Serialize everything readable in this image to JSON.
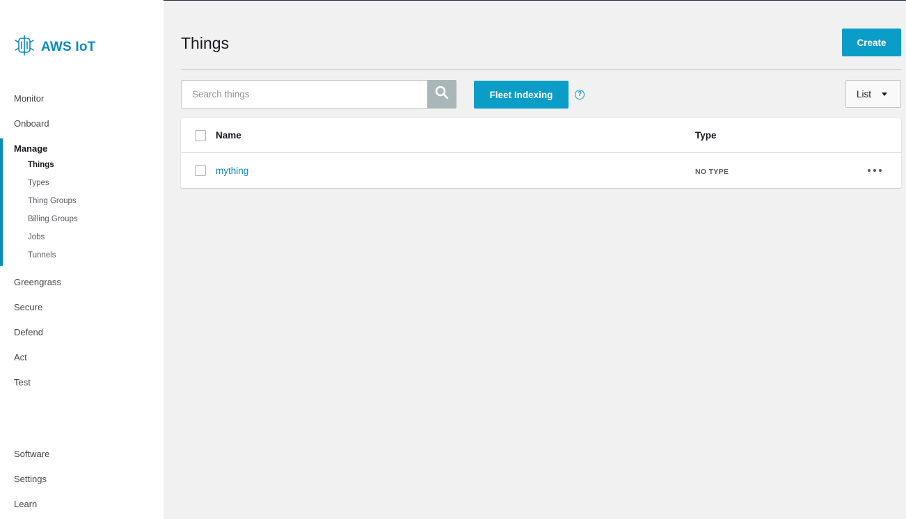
{
  "app": {
    "logo_text": "AWS IoT",
    "logo_icon": "iot-chip-icon"
  },
  "sidebar": {
    "items": [
      {
        "label": "Monitor"
      },
      {
        "label": "Onboard"
      },
      {
        "label": "Manage",
        "active": true
      },
      {
        "label": "Greengrass"
      },
      {
        "label": "Secure"
      },
      {
        "label": "Defend"
      },
      {
        "label": "Act"
      },
      {
        "label": "Test"
      }
    ],
    "manage_subitems": [
      {
        "label": "Things",
        "active": true
      },
      {
        "label": "Types"
      },
      {
        "label": "Thing Groups"
      },
      {
        "label": "Billing Groups"
      },
      {
        "label": "Jobs"
      },
      {
        "label": "Tunnels"
      }
    ],
    "footer_items": [
      {
        "label": "Software"
      },
      {
        "label": "Settings"
      },
      {
        "label": "Learn"
      }
    ]
  },
  "page": {
    "title": "Things",
    "create_label": "Create"
  },
  "search": {
    "placeholder": "Search things",
    "value": ""
  },
  "toolbar": {
    "fleet_indexing_label": "Fleet Indexing",
    "help_symbol": "?",
    "view_selected": "List"
  },
  "table": {
    "columns": [
      "Name",
      "Type"
    ],
    "rows": [
      {
        "name": "mything",
        "type": "NO TYPE"
      }
    ]
  },
  "colors": {
    "accent": "#0a9dc7",
    "link": "#0a8bb8",
    "background": "#f1f1f1",
    "sidebar_bg": "#ffffff"
  }
}
